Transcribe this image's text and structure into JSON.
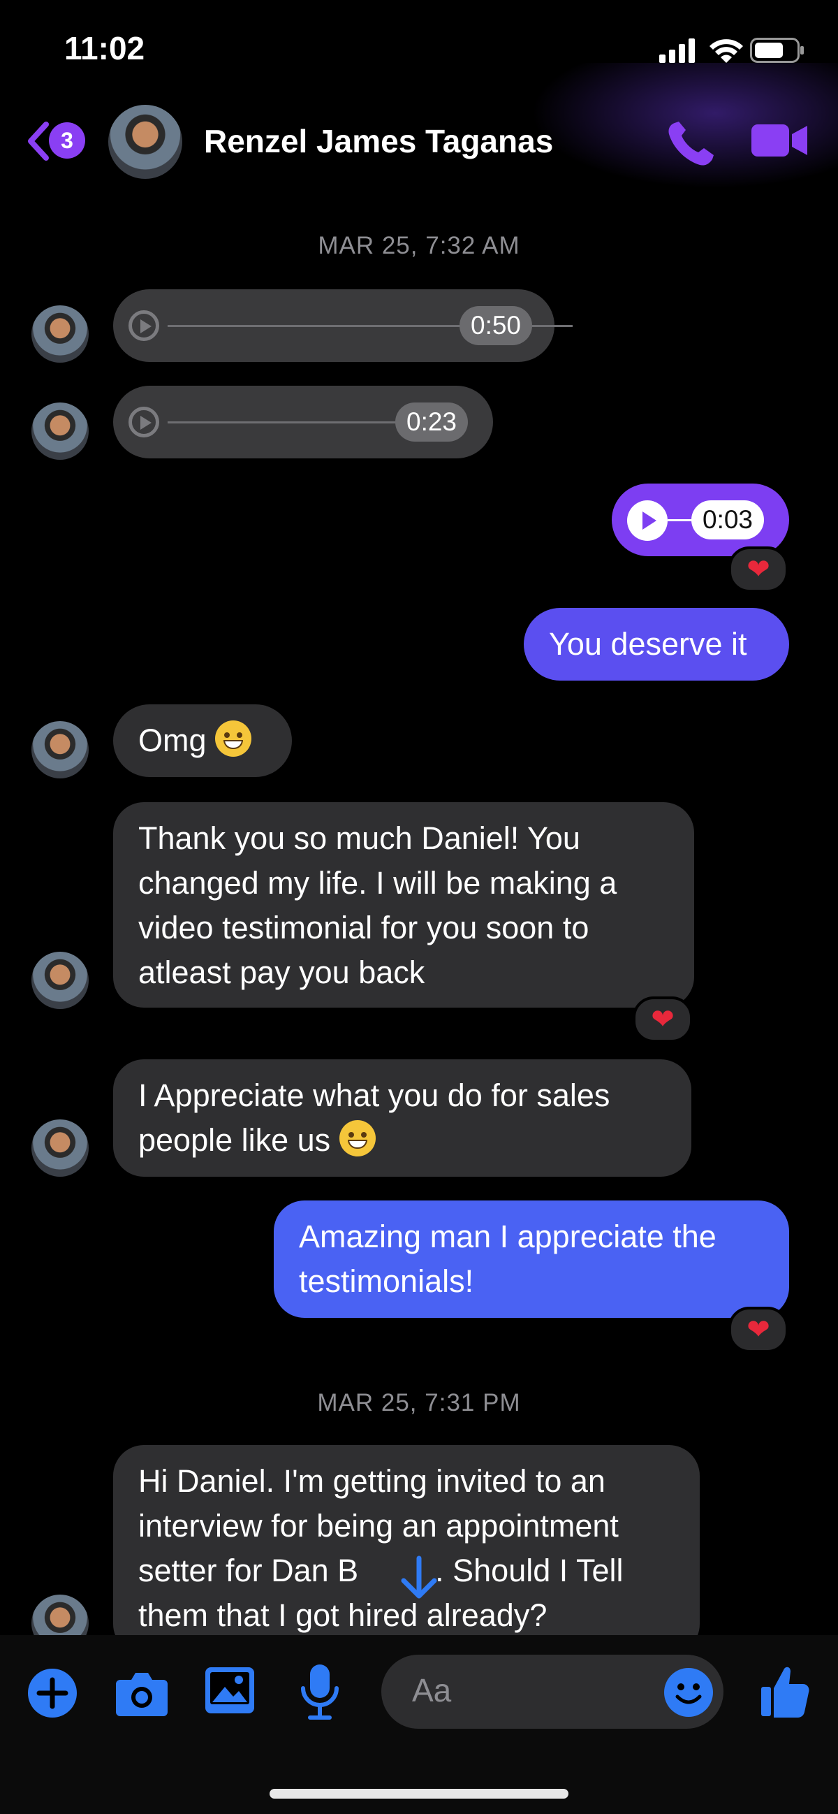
{
  "status_bar": {
    "time": "11:02"
  },
  "header": {
    "back_badge_count": "3",
    "contact_name": "Renzel James Taganas"
  },
  "messages": {
    "ts1": "MAR 25, 7:32 AM",
    "audio1_duration": "0:50",
    "audio2_duration": "0:23",
    "audio3_duration": "0:03",
    "msg_you_deserve": "You deserve it",
    "msg_omg": "Omg",
    "msg_thank_you_lines": [
      "Thank you so much Daniel! You",
      "changed my life. I will be making a",
      "video testimonial for you soon to",
      "atleast pay you back"
    ],
    "msg_appreciate_lines": [
      "I Appreciate what you do for sales",
      "people like us"
    ],
    "msg_amazing_lines": [
      "Amazing man I appreciate the",
      "testimonials!"
    ],
    "ts2": "MAR 25, 7:31 PM",
    "msg_hi_lines": [
      "Hi Daniel. I'm getting invited to an",
      "interview for being an appointment",
      "setter for Dan B",
      ". Should I Tell",
      "them that I got hired already?"
    ]
  },
  "composer": {
    "placeholder": "Aa"
  },
  "colors": {
    "accent": "#8a3ff3",
    "outgoing_purple": "#5b4ff0",
    "outgoing_blue": "#4a62f3",
    "incoming": "#2f2f31",
    "toolbar_blue": "#2f7bf5"
  },
  "icons": [
    "back-chevron-icon",
    "phone-icon",
    "video-camera-icon",
    "play-icon",
    "heart-icon",
    "add-icon",
    "camera-icon",
    "gallery-icon",
    "microphone-icon",
    "emoji-icon",
    "thumbs-up-icon",
    "scroll-down-icon"
  ]
}
